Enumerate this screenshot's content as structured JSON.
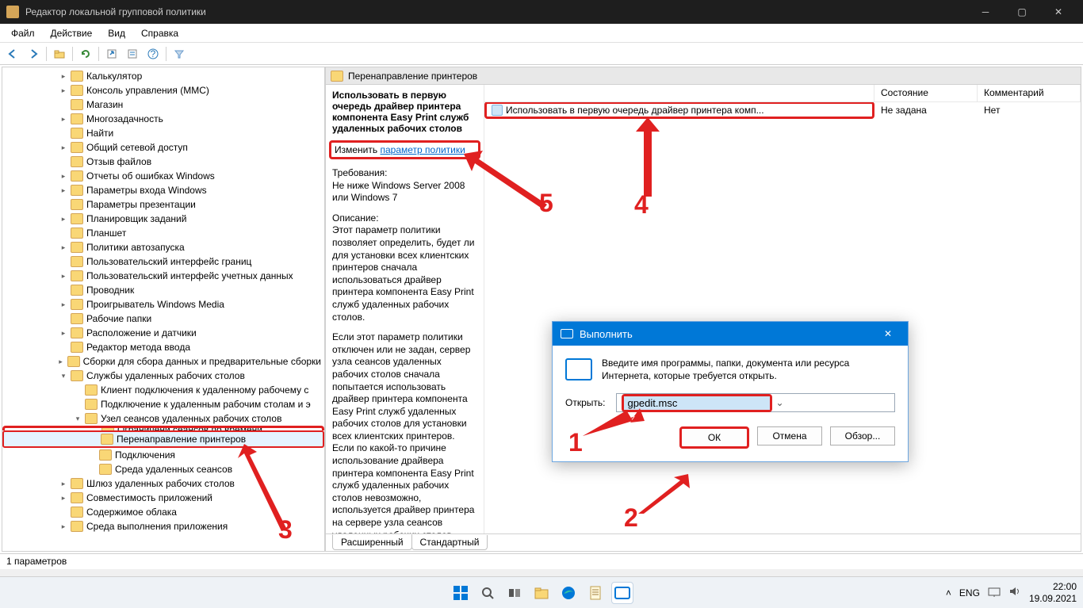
{
  "window": {
    "title": "Редактор локальной групповой политики"
  },
  "menu": {
    "file": "Файл",
    "action": "Действие",
    "view": "Вид",
    "help": "Справка"
  },
  "right": {
    "header": "Перенаправление принтеров",
    "policy_title": "Использовать в первую очередь драйвер принтера компонента Easy Print служб удаленных рабочих столов",
    "change_label": "Изменить",
    "policy_link": "параметр политики",
    "requirements_label": "Требования:",
    "requirements_text": "Не ниже Windows Server 2008 или Windows 7",
    "description_label": "Описание:",
    "description_p1": "Этот параметр политики позволяет определить, будет ли для установки всех клиентских принтеров сначала использоваться драйвер принтера компонента Easy Print служб удаленных рабочих столов.",
    "description_p2": "Если этот параметр политики отключен или не задан, сервер узла сеансов удаленных рабочих столов сначала попытается использовать драйвер принтера компонента Easy Print служб удаленных рабочих столов для установки всех клиентских принтеров. Если по какой-то причине использование драйвера принтера компонента Easy Print служб удаленных рабочих столов невозможно, используется драйвер принтера на сервере узла сеансов удаленных рабочих столов",
    "columns": {
      "state": "Состояние",
      "comment": "Комментарий"
    },
    "rows": [
      {
        "name": "Использовать в первую очередь драйвер принтера комп...",
        "state": "Не задана",
        "comment": "Нет"
      }
    ],
    "tabs": {
      "extended": "Расширенный",
      "standard": "Стандартный"
    }
  },
  "status": {
    "text": "1 параметров"
  },
  "tree": {
    "items": [
      {
        "indent": 70,
        "exp": ">",
        "label": "Калькулятор"
      },
      {
        "indent": 70,
        "exp": ">",
        "label": "Консоль управления (MMC)"
      },
      {
        "indent": 70,
        "exp": "",
        "label": "Магазин"
      },
      {
        "indent": 70,
        "exp": ">",
        "label": "Многозадачность"
      },
      {
        "indent": 70,
        "exp": "",
        "label": "Найти"
      },
      {
        "indent": 70,
        "exp": ">",
        "label": "Общий сетевой доступ"
      },
      {
        "indent": 70,
        "exp": "",
        "label": "Отзыв файлов"
      },
      {
        "indent": 70,
        "exp": ">",
        "label": "Отчеты об ошибках Windows"
      },
      {
        "indent": 70,
        "exp": ">",
        "label": "Параметры входа Windows"
      },
      {
        "indent": 70,
        "exp": "",
        "label": "Параметры презентации"
      },
      {
        "indent": 70,
        "exp": ">",
        "label": "Планировщик заданий"
      },
      {
        "indent": 70,
        "exp": "",
        "label": "Планшет"
      },
      {
        "indent": 70,
        "exp": ">",
        "label": "Политики автозапуска"
      },
      {
        "indent": 70,
        "exp": "",
        "label": "Пользовательский интерфейс границ"
      },
      {
        "indent": 70,
        "exp": ">",
        "label": "Пользовательский интерфейс учетных данных"
      },
      {
        "indent": 70,
        "exp": "",
        "label": "Проводник"
      },
      {
        "indent": 70,
        "exp": ">",
        "label": "Проигрыватель Windows Media"
      },
      {
        "indent": 70,
        "exp": "",
        "label": "Рабочие папки"
      },
      {
        "indent": 70,
        "exp": ">",
        "label": "Расположение и датчики"
      },
      {
        "indent": 70,
        "exp": "",
        "label": "Редактор метода ввода"
      },
      {
        "indent": 70,
        "exp": ">",
        "label": "Сборки для сбора данных и предварительные сборки"
      },
      {
        "indent": 70,
        "exp": "v",
        "label": "Службы удаленных рабочих столов"
      },
      {
        "indent": 88,
        "exp": "",
        "label": "Клиент подключения к удаленному рабочему с"
      },
      {
        "indent": 88,
        "exp": "",
        "label": "Подключение к удаленным рабочим столам и э"
      },
      {
        "indent": 88,
        "exp": "v",
        "label": "Узел сеансов удаленных рабочих столов"
      },
      {
        "indent": 106,
        "exp": "",
        "label": "Ограничени сеансов по времени",
        "hidden_top": true
      },
      {
        "indent": 106,
        "exp": "",
        "label": "Перенаправление принтеров",
        "selected": true
      },
      {
        "indent": 106,
        "exp": "",
        "label": "Подключения"
      },
      {
        "indent": 106,
        "exp": "",
        "label": "Среда удаленных сеансов"
      },
      {
        "indent": 70,
        "exp": ">",
        "label": "Шлюз удаленных рабочих столов"
      },
      {
        "indent": 70,
        "exp": ">",
        "label": "Совместимость приложений"
      },
      {
        "indent": 70,
        "exp": "",
        "label": "Содержимое облака"
      },
      {
        "indent": 70,
        "exp": ">",
        "label": "Среда выполнения приложения"
      }
    ]
  },
  "run": {
    "title": "Выполнить",
    "desc": "Введите имя программы, папки, документа или ресурса Интернета, которые требуется открыть.",
    "open_label": "Открыть:",
    "value": "gpedit.msc",
    "ok": "ОК",
    "cancel": "Отмена",
    "browse": "Обзор..."
  },
  "annotations": {
    "n1": "1",
    "n2": "2",
    "n3": "3",
    "n4": "4",
    "n5": "5"
  },
  "tray": {
    "lang": "ENG",
    "time": "22:00",
    "date": "19.09.2021"
  }
}
